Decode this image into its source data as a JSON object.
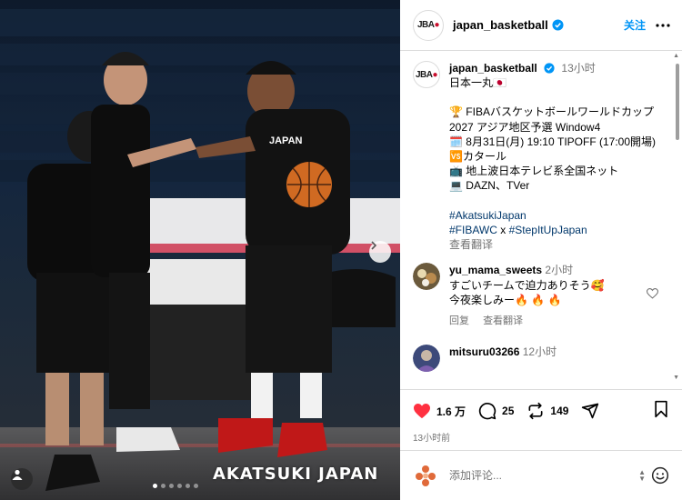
{
  "post": {
    "watermark": "AKATSUKI JAPAN",
    "jersey_text": "JAPAN",
    "carousel": {
      "count": 6,
      "active": 1
    }
  },
  "header": {
    "logo": "JBA",
    "username": "japan_basketball",
    "follow_label": "关注",
    "more_icon": "more-horizontal-icon"
  },
  "caption": {
    "username": "japan_basketball",
    "time": "13小时",
    "lines": [
      "日本一丸🇯🇵",
      "",
      "🏆 FIBAバスケットボールワールドカップ2027 アジア地区予選 Window4",
      "🗓️ 8月31日(月) 19:10 TIPOFF (17:00開場)",
      "🆚カタール",
      "📺 地上波日本テレビ系全国ネット",
      "💻 DAZN、TVer",
      ""
    ],
    "hashtag1": "#AkatsukiJapan",
    "hashtag2": "#FIBAWC",
    "x": " x ",
    "hashtag3": "#StepItUpJapan",
    "see_translation": "查看翻译"
  },
  "comments": [
    {
      "username": "yu_mama_sweets",
      "time": "2小时",
      "text1": "すごいチームで迫力ありそう🥰",
      "text2": "今夜楽しみー🔥 🔥 🔥",
      "reply": "回复",
      "translate": "查看翻译"
    },
    {
      "username": "mitsuru03266",
      "time": "12小时"
    }
  ],
  "actions": {
    "likes": "1.6 万",
    "comments": "25",
    "reposts": "149",
    "posted": "13小时前"
  },
  "add_comment": {
    "placeholder": "添加评论..."
  },
  "colors": {
    "accent": "#0095f6",
    "like": "#ff3040",
    "brand_red": "#c8102e"
  }
}
